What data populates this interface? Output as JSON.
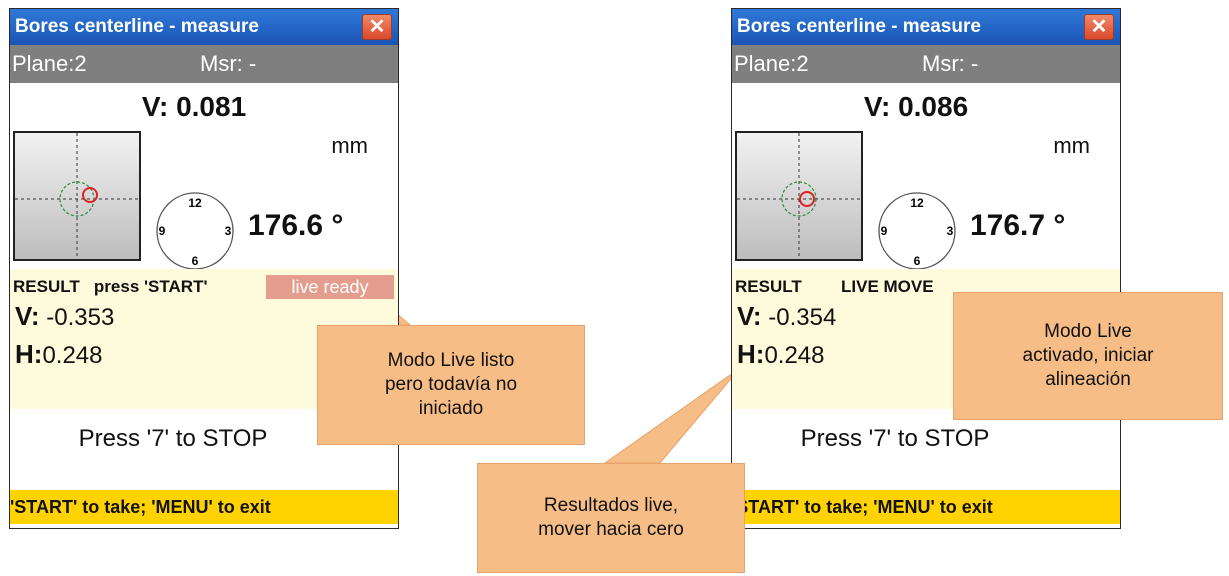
{
  "colors": {
    "titlebar": "#1a55b5",
    "planebar": "#7f7f7f",
    "statusbar": "#ffd200",
    "result_bg": "#fdfbdc",
    "callout": "#f6bd86",
    "live_ready_badge": "#e59d8f"
  },
  "windows": [
    {
      "title": "Bores centerline - measure",
      "close_glyph": "✕",
      "plane": "Plane:2",
      "msr": "Msr: -",
      "v_top": "V: 0.081",
      "unit": "mm",
      "clock": {
        "n12": "12",
        "n3": "3",
        "n6": "6",
        "n9": "9"
      },
      "angle": "176.6 °",
      "result_label": "RESULT",
      "result_status": "press 'START'",
      "badge": "live ready",
      "v_label": "V:",
      "v_value": "-0.353",
      "h_label": "H:",
      "h_value": "0.248",
      "stop_text": "Press '7' to STOP",
      "status": "'START' to take; 'MENU' to exit"
    },
    {
      "title": "Bores centerline - measure",
      "close_glyph": "✕",
      "plane": "Plane:2",
      "msr": "Msr: -",
      "v_top": "V: 0.086",
      "unit": "mm",
      "clock": {
        "n12": "12",
        "n3": "3",
        "n6": "6",
        "n9": "9"
      },
      "angle": "176.7 °",
      "result_label": "RESULT",
      "result_status": "LIVE MOVE",
      "v_label": "V:",
      "v_value": "-0.354",
      "h_label": "H:",
      "h_value": "0.248",
      "stop_text": "Press '7' to STOP",
      "status": "'START' to take; 'MENU' to exit"
    }
  ],
  "callouts": [
    {
      "text": "Modo Live listo\npero todavía no\niniciado"
    },
    {
      "text": "Resultados live,\nmover hacia cero"
    },
    {
      "text": "Modo Live\nactivado, iniciar\nalineación"
    }
  ]
}
